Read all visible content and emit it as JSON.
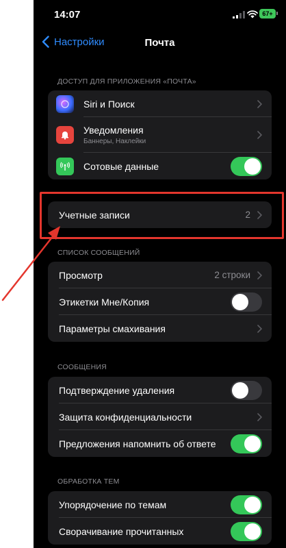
{
  "status_bar": {
    "time": "14:07",
    "battery": "67+"
  },
  "nav": {
    "back_label": "Настройки",
    "title": "Почта"
  },
  "sections": {
    "access": {
      "header": "ДОСТУП ДЛЯ ПРИЛОЖЕНИЯ «ПОЧТА»",
      "siri": "Siri и Поиск",
      "notifications": "Уведомления",
      "notifications_sub": "Баннеры, Наклейки",
      "cellular": "Сотовые данные"
    },
    "accounts": {
      "label": "Учетные записи",
      "value": "2"
    },
    "message_list": {
      "header": "СПИСОК СООБЩЕНИЙ",
      "preview": "Просмотр",
      "preview_value": "2 строки",
      "to_cc": "Этикетки Мне/Копия",
      "swipe": "Параметры смахивания"
    },
    "messages": {
      "header": "СООБЩЕНИЯ",
      "ask_delete": "Подтверждение удаления",
      "privacy": "Защита конфиденциальности",
      "followup": "Предложения напомнить об ответе"
    },
    "threading": {
      "header": "ОБРАБОТКА ТЕМ",
      "organize": "Упорядочение по темам",
      "collapse": "Сворачивание прочитанных"
    }
  },
  "toggles": {
    "cellular": true,
    "to_cc": false,
    "ask_delete": false,
    "followup": true,
    "organize": true,
    "collapse": true
  },
  "colors": {
    "accent": "#2f8cff",
    "toggle_on": "#34c759",
    "highlight": "#e4362d"
  }
}
